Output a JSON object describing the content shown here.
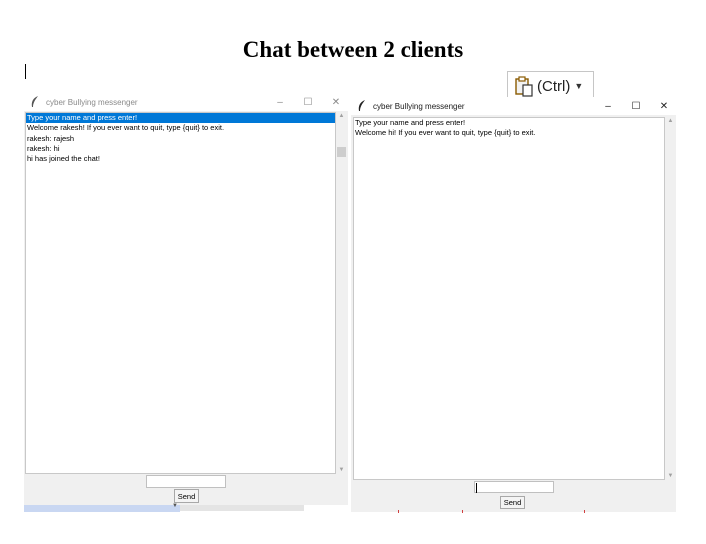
{
  "document": {
    "title": "Chat between 2 clients"
  },
  "paste_options": {
    "label": "(Ctrl)",
    "icon": "clipboard-icon"
  },
  "windows": [
    {
      "title": "cyber Bullying messenger",
      "active": false,
      "messages": [
        {
          "text": "Type your name and press enter!",
          "selected": true
        },
        {
          "text": "Welcome rakesh! If you ever want to quit, type {quit} to exit.",
          "selected": false
        },
        {
          "text": "rakesh: rajesh",
          "selected": false
        },
        {
          "text": "rakesh: hi",
          "selected": false
        },
        {
          "text": "hi has joined the chat!",
          "selected": false
        }
      ],
      "entry_value": "",
      "send_label": "Send"
    },
    {
      "title": "cyber Bullying messenger",
      "active": true,
      "messages": [
        {
          "text": "Type your name and press enter!",
          "selected": false
        },
        {
          "text": "Welcome hi! If you ever want to quit, type {quit} to exit.",
          "selected": false
        }
      ],
      "entry_value": "",
      "send_label": "Send"
    }
  ],
  "colors": {
    "selection": "#0078d7",
    "window_bg": "#f0f0f0"
  }
}
